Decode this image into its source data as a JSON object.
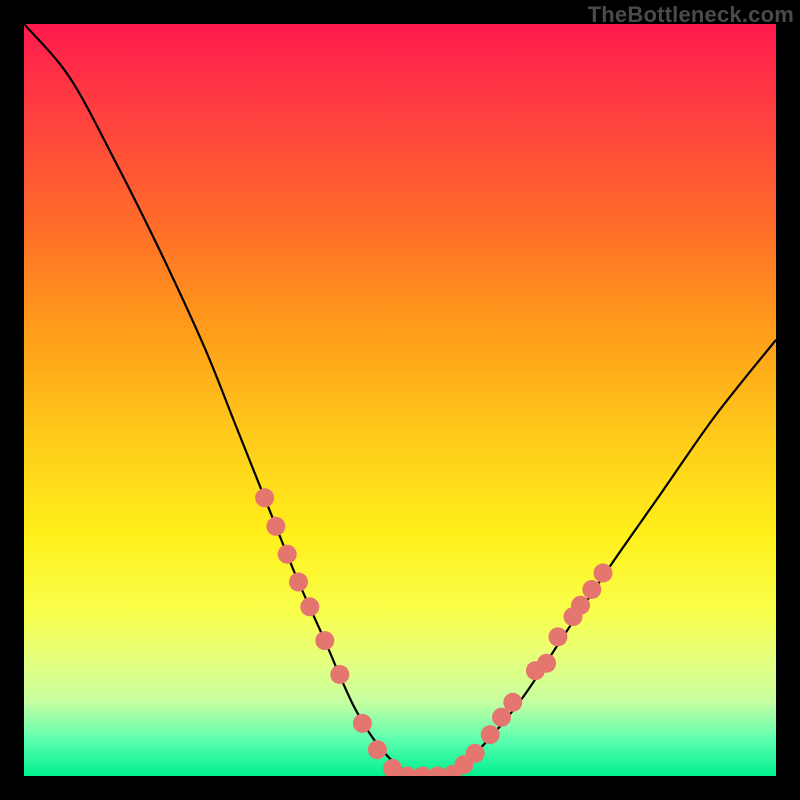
{
  "watermark": "TheBottleneck.com",
  "colors": {
    "background": "#000000",
    "gradient_top": "#ff1a4d",
    "gradient_bottom": "#00f090",
    "curve": "#000000",
    "marker": "#e4766f"
  },
  "chart_data": {
    "type": "line",
    "title": "",
    "xlabel": "",
    "ylabel": "",
    "xlim": [
      0,
      100
    ],
    "ylim": [
      0,
      100
    ],
    "x": [
      0,
      6,
      12,
      18,
      24,
      28,
      32,
      36,
      40,
      44,
      48,
      52,
      56,
      60,
      66,
      72,
      78,
      85,
      92,
      100
    ],
    "values": [
      100,
      93,
      82,
      70,
      57,
      47,
      37,
      27,
      18,
      9,
      3,
      0,
      0,
      3,
      10,
      19,
      28,
      38,
      48,
      58
    ],
    "series": [
      {
        "name": "bottleneck-curve",
        "values": [
          100,
          93,
          82,
          70,
          57,
          47,
          37,
          27,
          18,
          9,
          3,
          0,
          0,
          3,
          10,
          19,
          28,
          38,
          48,
          58
        ]
      }
    ],
    "markers": [
      {
        "x": 32.0,
        "y": 37.0
      },
      {
        "x": 33.5,
        "y": 33.2
      },
      {
        "x": 35.0,
        "y": 29.5
      },
      {
        "x": 36.5,
        "y": 25.8
      },
      {
        "x": 38.0,
        "y": 22.5
      },
      {
        "x": 40.0,
        "y": 18.0
      },
      {
        "x": 42.0,
        "y": 13.5
      },
      {
        "x": 45.0,
        "y": 7.0
      },
      {
        "x": 47.0,
        "y": 3.5
      },
      {
        "x": 49.0,
        "y": 1.0
      },
      {
        "x": 51.0,
        "y": 0.0
      },
      {
        "x": 53.0,
        "y": 0.0
      },
      {
        "x": 55.0,
        "y": 0.0
      },
      {
        "x": 57.0,
        "y": 0.2
      },
      {
        "x": 58.5,
        "y": 1.5
      },
      {
        "x": 60.0,
        "y": 3.0
      },
      {
        "x": 62.0,
        "y": 5.5
      },
      {
        "x": 63.5,
        "y": 7.8
      },
      {
        "x": 65.0,
        "y": 9.8
      },
      {
        "x": 68.0,
        "y": 14.0
      },
      {
        "x": 69.5,
        "y": 15.0
      },
      {
        "x": 71.0,
        "y": 18.5
      },
      {
        "x": 73.0,
        "y": 21.2
      },
      {
        "x": 74.0,
        "y": 22.7
      },
      {
        "x": 75.5,
        "y": 24.8
      },
      {
        "x": 77.0,
        "y": 27.0
      }
    ]
  }
}
